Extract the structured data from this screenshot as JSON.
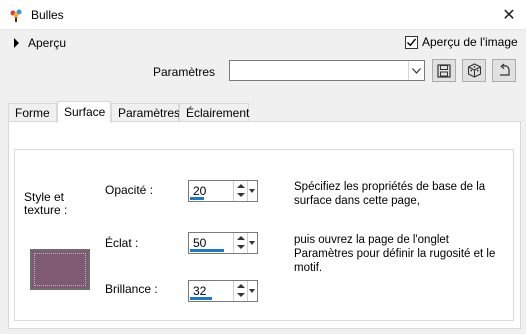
{
  "window": {
    "title": "Bulles",
    "close_glyph": "✕"
  },
  "toolbar": {
    "preview_toggle_label": "Aperçu",
    "show_preview_label": "Aperçu de l'image",
    "show_preview_checked": true,
    "presets_label": "Paramètres",
    "presets_value": ""
  },
  "tabs": [
    {
      "label": "Forme",
      "active": false
    },
    {
      "label": "Surface",
      "active": true
    },
    {
      "label": "Paramètres",
      "active": false
    },
    {
      "label": "Éclairement",
      "active": false
    }
  ],
  "surface": {
    "style_label": "Style et texture :",
    "swatch_color": "#7e5b72",
    "fields": [
      {
        "label": "Opacité :",
        "value": "20",
        "fraction": 0.2
      },
      {
        "label": "Éclat :",
        "value": "50",
        "fraction": 0.5
      },
      {
        "label": "Brillance :",
        "value": "32",
        "fraction": 0.32
      }
    ],
    "help_text_1": "Spécifiez les propriétés de base de la surface dans cette page,",
    "help_text_2": "puis ouvrez la page de l'onglet Paramètres pour définir la rugosité et le motif."
  },
  "colors": {
    "accent_bar": "#1979ca",
    "window_bg": "#f0f0f0"
  },
  "icons": [
    "app-icon",
    "close-icon",
    "save-preset-icon",
    "random-icon",
    "reset-icon"
  ]
}
